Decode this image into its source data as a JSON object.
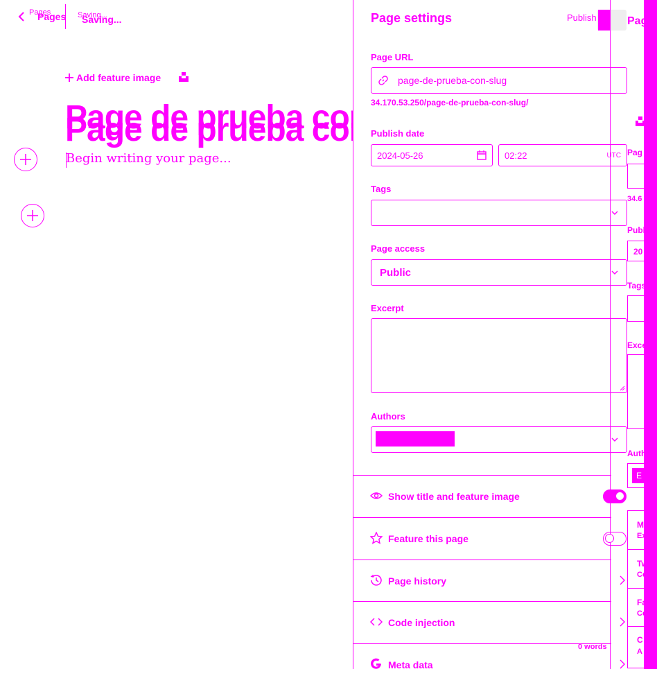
{
  "editor": {
    "back_label": "Pages",
    "back_ghost_label": "Pages",
    "status": "Saving...",
    "status_ghost": "Saving...",
    "add_feature_image": "Add feature image",
    "title": "Page de prueba con slug",
    "body_placeholder": "Begin writing your page...",
    "word_count": "0 words"
  },
  "settings": {
    "title": "Page settings",
    "publish_label": "Publish",
    "url": {
      "label": "Page URL",
      "value": "page-de-prueba-con-slug",
      "hint": "34.170.53.250/page-de-prueba-con-slug/"
    },
    "publish_date": {
      "label": "Publish date",
      "date": "2024-05-26",
      "time": "02:22",
      "timezone": "UTC"
    },
    "tags": {
      "label": "Tags",
      "value": ""
    },
    "access": {
      "label": "Page access",
      "value": "Public"
    },
    "excerpt": {
      "label": "Excerpt",
      "value": ""
    },
    "authors": {
      "label": "Authors"
    },
    "rows": [
      {
        "label": "Show title and feature image",
        "icon": "eye-icon",
        "toggle": "on"
      },
      {
        "label": "Feature this page",
        "icon": "star-icon",
        "toggle": "off"
      },
      {
        "label": "Page history",
        "icon": "history-icon"
      },
      {
        "label": "Code injection",
        "icon": "code-icon"
      },
      {
        "label": "Meta data",
        "icon": "google-icon"
      }
    ]
  },
  "ghost_strip": {
    "title_fragment": "Pag",
    "url_fragment": "34.6",
    "pub_fragment": "Publ",
    "date_fragment": "20",
    "tags_fragment": "Tags",
    "excerpt_fragment": "Exce",
    "authors_fragment": "Auth",
    "chip_fragment": "E",
    "m_fragment": "M",
    "ex_fragment": "Ex",
    "tw_fragment": "Tw",
    "c1_fragment": "Co",
    "fa_fragment": "Fa",
    "c2_fragment": "Co",
    "c3_fragment": "C",
    "a_fragment": "A"
  },
  "colors": {
    "accent": "#ff00ff",
    "background": "#ffffff"
  }
}
